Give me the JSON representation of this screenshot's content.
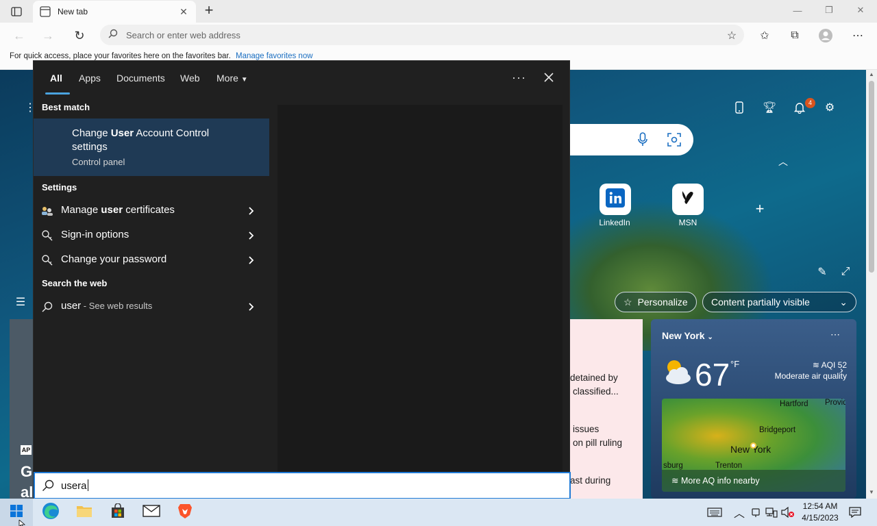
{
  "browser": {
    "tab_title": "New tab",
    "address_placeholder": "Search or enter web address",
    "favorites_hint": "For quick access, place your favorites here on the favorites bar.",
    "favorites_link": "Manage favorites now"
  },
  "ntp": {
    "notification_count": "4",
    "tiles": [
      {
        "label": "LinkedIn",
        "icon": "linkedin-icon"
      },
      {
        "label": "MSN",
        "icon": "msn-icon"
      }
    ],
    "personalize_label": "Personalize",
    "content_label": "Content partially visible",
    "news_lines": [
      "detained by",
      "classified...",
      "issues",
      "on pill ruling",
      "ast during"
    ],
    "left_card_text": [
      "G",
      "al"
    ],
    "left_card_badge": "AP"
  },
  "weather": {
    "city": "New York",
    "temp": "67",
    "unit": "°F",
    "aqi": "AQI 52",
    "aqi_desc": "Moderate air quality",
    "map_labels": [
      "Hartford",
      "Providen",
      "Bridgeport",
      "New York",
      "Trenton",
      "sburg"
    ],
    "map_footer": "More AQ info nearby"
  },
  "search": {
    "tabs": [
      "All",
      "Apps",
      "Documents",
      "Web",
      "More"
    ],
    "best_match_heading": "Best match",
    "best_match": {
      "title_prefix": "Change ",
      "title_bold": "User",
      "title_suffix": " Account Control settings",
      "subtitle": "Control panel"
    },
    "settings_heading": "Settings",
    "settings_items": [
      {
        "prefix": "Manage ",
        "bold": "user",
        "suffix": " certificates"
      },
      {
        "prefix": "Sign-in options",
        "bold": "",
        "suffix": ""
      },
      {
        "prefix": "Change your password",
        "bold": "",
        "suffix": ""
      }
    ],
    "web_heading": "Search the web",
    "web_item": {
      "term": "user",
      "suffix": " - See web results"
    },
    "query": "usera"
  },
  "taskbar": {
    "time": "12:54 AM",
    "date": "4/15/2023"
  }
}
